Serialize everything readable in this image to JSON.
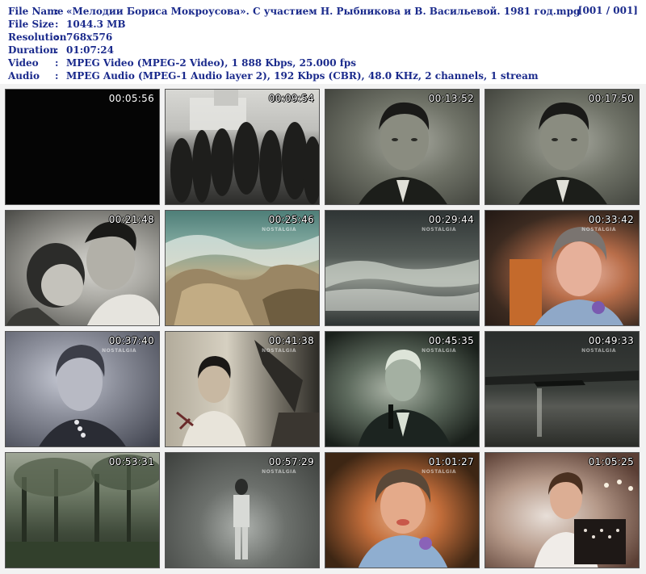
{
  "header": {
    "counter": "[001 / 001]",
    "rows": [
      {
        "label": "File Name",
        "value": "«Мелодии Бориса Мокроусова». С участием Н. Рыбникова и В. Васильевой. 1981 год.mpg"
      },
      {
        "label": "File Size",
        "value": "1044.3 MB"
      },
      {
        "label": "Resolution",
        "value": "768x576"
      },
      {
        "label": "Duration",
        "value": "01:07:24"
      },
      {
        "label": "Video",
        "value": "MPEG Video (MPEG-2 Video), 1 888 Kbps, 25.000 fps"
      },
      {
        "label": "Audio",
        "value": "MPEG Audio (MPEG-1 Audio layer 2), 192 Kbps (CBR), 48.0 KHz, 2 channels, 1 stream"
      }
    ],
    "colon": ":"
  },
  "thumbnails": [
    {
      "time": "00:05:56",
      "scene": "black"
    },
    {
      "time": "00:09:54",
      "scene": "crowd"
    },
    {
      "time": "00:13:52",
      "scene": "portrait"
    },
    {
      "time": "00:17:50",
      "scene": "portrait"
    },
    {
      "time": "00:21:48",
      "scene": "kiss"
    },
    {
      "time": "00:25:46",
      "scene": "waves",
      "watermark": "NOSTALGIA"
    },
    {
      "time": "00:29:44",
      "scene": "sea",
      "watermark": "NOSTALGIA"
    },
    {
      "time": "00:33:42",
      "scene": "woman-red",
      "watermark": "NOSTALGIA"
    },
    {
      "time": "00:37:40",
      "scene": "woman-bw",
      "watermark": "NOSTALGIA"
    },
    {
      "time": "00:41:38",
      "scene": "poster",
      "watermark": "NOSTALGIA"
    },
    {
      "time": "00:45:35",
      "scene": "singer",
      "watermark": "NOSTALGIA"
    },
    {
      "time": "00:49:33",
      "scene": "night",
      "watermark": "NOSTALGIA"
    },
    {
      "time": "00:53:31",
      "scene": "forest"
    },
    {
      "time": "00:57:29",
      "scene": "stage",
      "watermark": "NOSTALGIA"
    },
    {
      "time": "01:01:27",
      "scene": "woman-blue",
      "watermark": "NOSTALGIA"
    },
    {
      "time": "01:05:25",
      "scene": "accordion"
    }
  ],
  "colors": {
    "header_text": "#1a2a8c",
    "grid_background": "#f2f2f2",
    "timestamp": "#ffffff"
  }
}
